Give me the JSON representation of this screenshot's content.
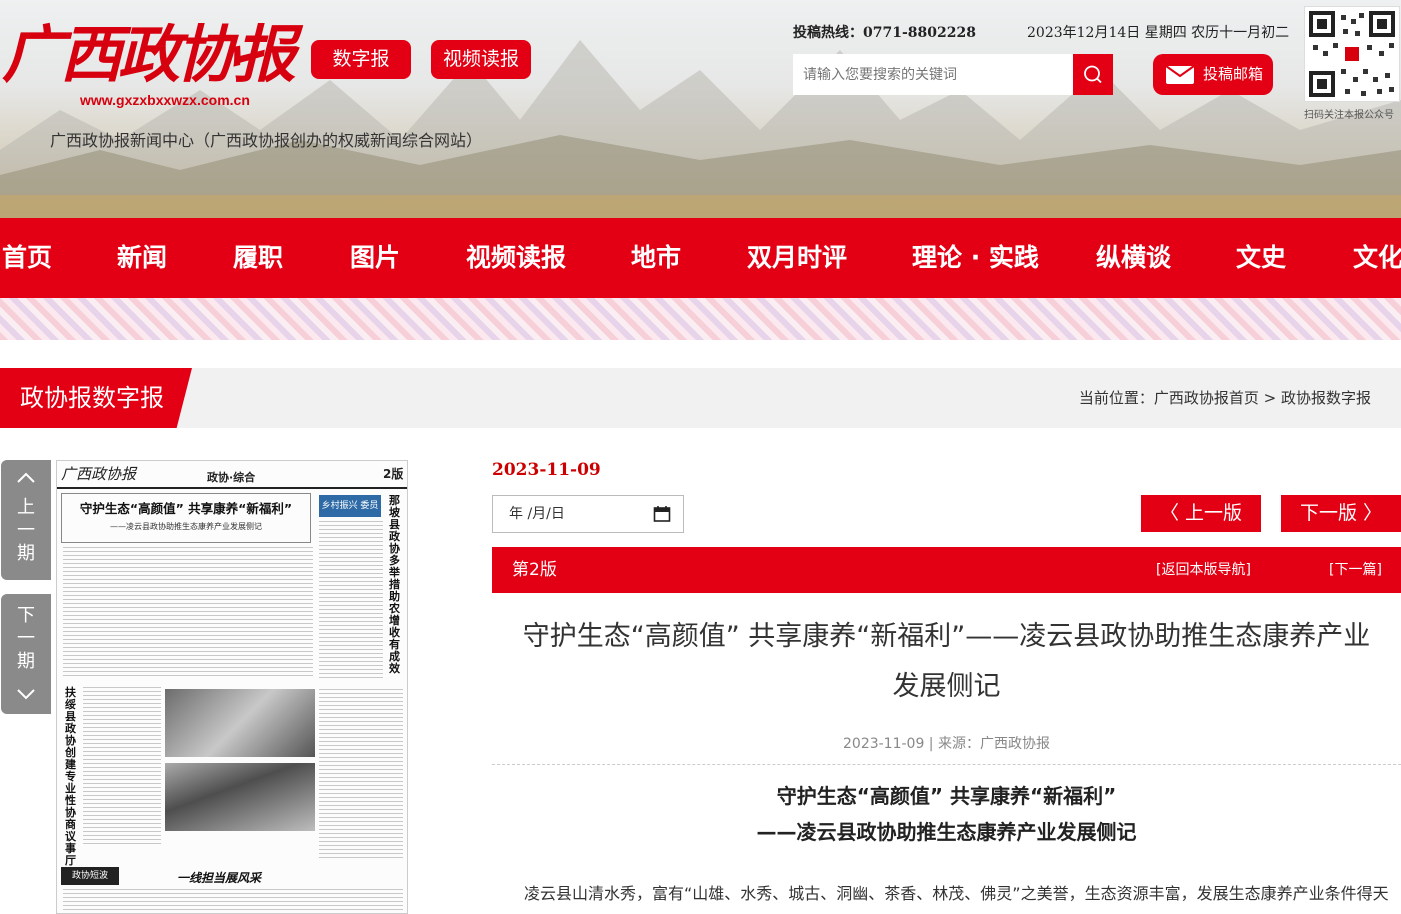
{
  "header": {
    "logo_text": "广西政协报",
    "logo_url": "www.gxzxbxxwzx.com.cn",
    "site_desc": "广西政协报新闻中心（广西政协报创办的权威新闻综合网站）",
    "btn_digital": "数字报",
    "btn_video": "视频读报",
    "hotline": "投稿热线：0771-8802228",
    "date": "2023年12月14日 星期四 农历十一月初二",
    "search_placeholder": "请输入您要搜索的关键词",
    "mail_label": "投稿邮箱",
    "qr_caption": "扫码关注本报公众号"
  },
  "nav": [
    "首页",
    "新闻",
    "履职",
    "图片",
    "视频读报",
    "地市",
    "双月时评",
    "理论 · 实践",
    "纵横谈",
    "文史",
    "文化"
  ],
  "titlebar": {
    "label": "政协报数字报",
    "crumb": "当前位置：广西政协报首页 > 政协报数字报"
  },
  "side": {
    "prev": [
      "上",
      "一",
      "期"
    ],
    "next": [
      "下",
      "一",
      "期"
    ]
  },
  "paper": {
    "masthead": "广西政协报",
    "section": "政协·综合",
    "page_no": "2版",
    "headline": "守护生态“高颜值” 共享康养“新福利”",
    "subhead": "——凌云县政协助推生态康养产业发展侧记",
    "vert_head": "那坡县政协多举措助农增收有成效",
    "vert_head2": "扶绥县政协创建专业性协商议事厅",
    "side_tag": "乡村振兴 委员行动",
    "bottom_head": "一线担当展风采",
    "bottom_tag": "政协短波"
  },
  "main": {
    "issue_date": "2023-11-09",
    "date_input_placeholder": "年 /月/日",
    "prev_label": "〈 上一版",
    "next_label": "下一版 〉",
    "page_label": "第2版",
    "back_nav": "[返回本版导航]",
    "next_article": "[下一篇]",
    "title": "守护生态“高颜值” 共享康养“新福利”——凌云县政协助推生态康养产业发展侧记",
    "meta": "2023-11-09 | 来源：广西政协报",
    "sub_title1": "守护生态“高颜值” 共享康养“新福利”",
    "sub_title2": "——凌云县政协助推生态康养产业发展侧记",
    "body": "凌云县山清水秀，富有“山雄、水秀、城古、洞幽、茶香、林茂、佛灵”之美誉，生态资源丰富，发展生态康养产业条件得天"
  },
  "colors": {
    "accent": "#e40014",
    "side_tab": "#8a8a8a"
  }
}
